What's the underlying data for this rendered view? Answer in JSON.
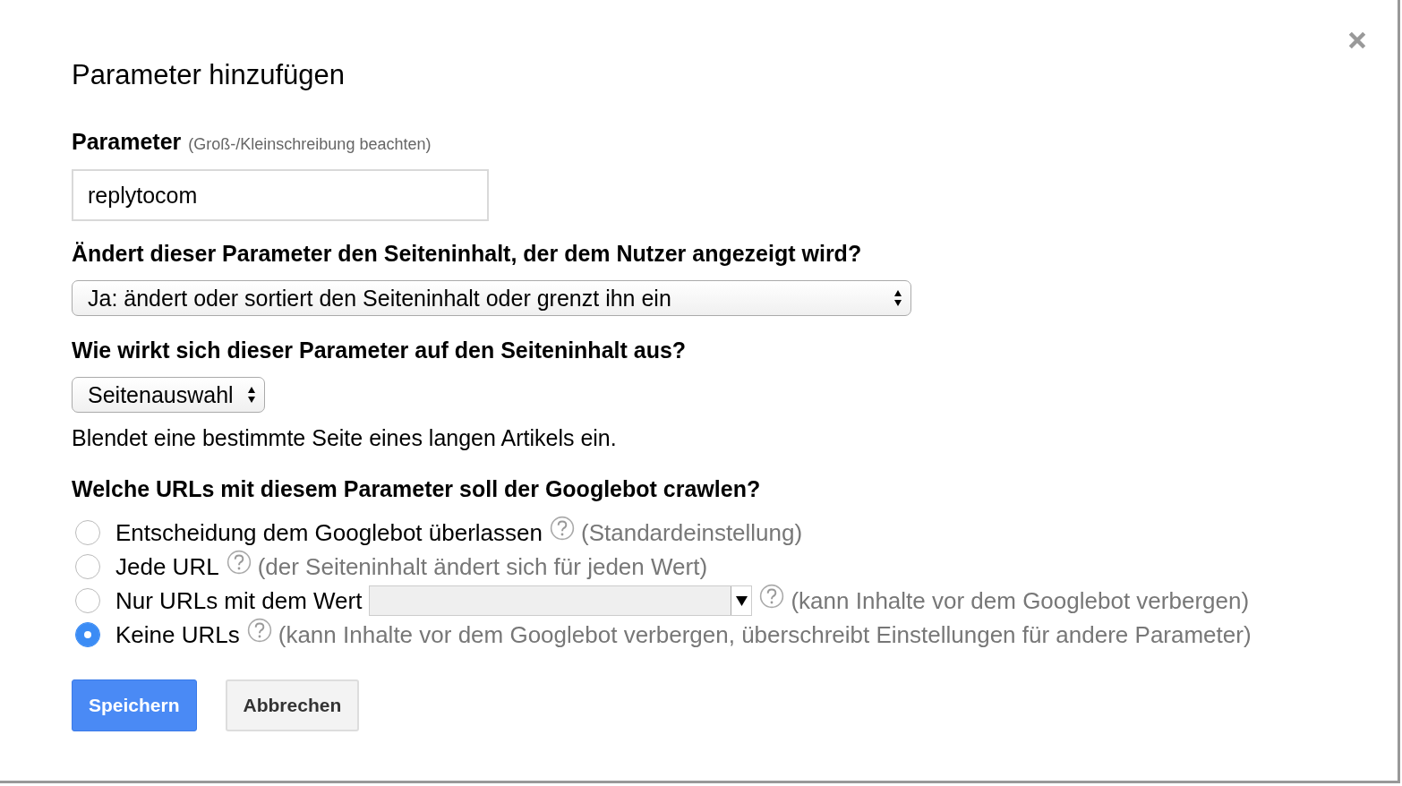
{
  "dialog": {
    "title": "Parameter hinzufügen"
  },
  "parameter": {
    "label": "Parameter",
    "hint": "(Groß-/Kleinschreibung beachten)",
    "value": "replytocom"
  },
  "content_question": {
    "label": "Ändert dieser Parameter den Seiteninhalt, der dem Nutzer angezeigt wird?",
    "value": "Ja: ändert oder sortiert den Seiteninhalt oder grenzt ihn ein"
  },
  "effect_question": {
    "label": "Wie wirkt sich dieser Parameter auf den Seiteninhalt aus?",
    "value": "Seitenauswahl",
    "description": "Blendet eine bestimmte Seite eines langen Artikels ein."
  },
  "crawl_question": {
    "label": "Welche URLs mit diesem Parameter soll der Googlebot crawlen?",
    "options": [
      {
        "kind": "plain",
        "label": "Entscheidung dem Googlebot überlassen",
        "note": "(Standardeinstellung)",
        "selected": false
      },
      {
        "kind": "plain",
        "label": "Jede URL",
        "note": "(der Seiteninhalt ändert sich für jeden Wert)",
        "selected": false
      },
      {
        "kind": "value_select",
        "label": "Nur URLs mit dem Wert",
        "note": "(kann Inhalte vor dem Googlebot verbergen)",
        "selected": false
      },
      {
        "kind": "plain",
        "label": "Keine URLs",
        "note": "(kann Inhalte vor dem Googlebot verbergen, überschreibt Einstellungen für andere Parameter)",
        "selected": true
      }
    ]
  },
  "buttons": [
    {
      "kind": "primary",
      "label": "Speichern"
    },
    {
      "kind": "secondary",
      "label": "Abbrechen"
    }
  ]
}
